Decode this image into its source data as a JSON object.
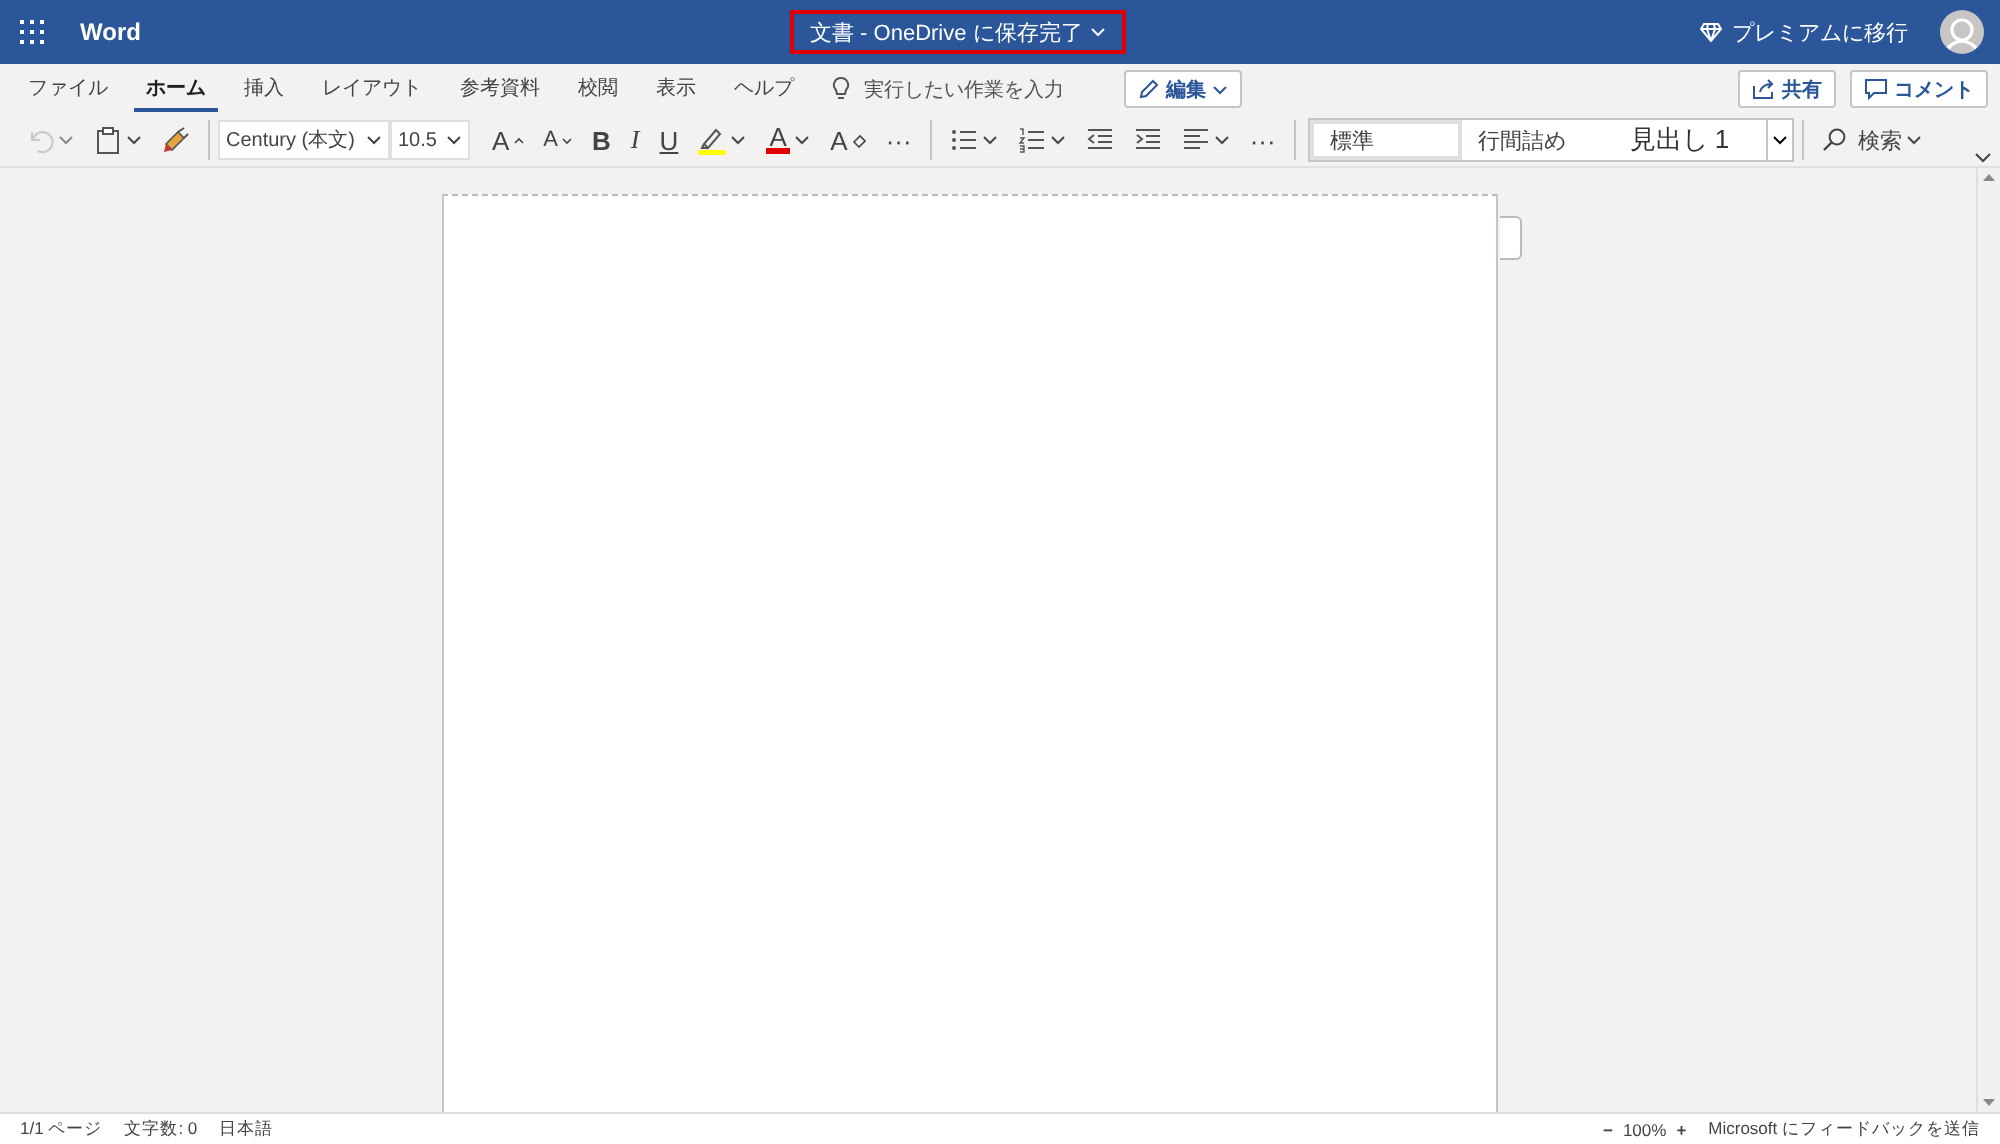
{
  "app": {
    "name": "Word",
    "doc_title": "文書 - OneDrive に保存完了",
    "title_highlighted": true,
    "premium": "プレミアムに移行"
  },
  "tabs": [
    {
      "label": "ファイル",
      "selected": false
    },
    {
      "label": "ホーム",
      "selected": true
    },
    {
      "label": "挿入",
      "selected": false
    },
    {
      "label": "レイアウト",
      "selected": false
    },
    {
      "label": "参考資料",
      "selected": false
    },
    {
      "label": "校閲",
      "selected": false
    },
    {
      "label": "表示",
      "selected": false
    },
    {
      "label": "ヘルプ",
      "selected": false
    }
  ],
  "tell_me": {
    "placeholder": "実行したい作業を入力"
  },
  "mode_button": "編集",
  "share_button": "共有",
  "comment_button": "コメント",
  "toolbar": [
    {
      "kind": "undo",
      "dropdown": true,
      "disabled": true
    },
    {
      "kind": "paste",
      "dropdown": true,
      "disabled": false
    },
    {
      "kind": "painter",
      "dropdown": false,
      "disabled": false
    },
    {
      "kind": "sep"
    },
    {
      "kind": "font",
      "value": "Century (本文)"
    },
    {
      "kind": "size",
      "value": "10.5"
    },
    {
      "kind": "grow",
      "label": "A"
    },
    {
      "kind": "shrink",
      "label": "A"
    },
    {
      "kind": "bold",
      "label": "B"
    },
    {
      "kind": "italic",
      "label": "I"
    },
    {
      "kind": "underline",
      "label": "U"
    },
    {
      "kind": "highlight",
      "dropdown": true,
      "color": "#ffff00"
    },
    {
      "kind": "fontcolor",
      "label": "A",
      "dropdown": true,
      "color": "#e00000"
    },
    {
      "kind": "clear",
      "label": "A"
    },
    {
      "kind": "more",
      "label": "···"
    },
    {
      "kind": "sep"
    },
    {
      "kind": "bullets",
      "dropdown": true
    },
    {
      "kind": "numbering",
      "dropdown": true
    },
    {
      "kind": "outdent",
      "dropdown": false
    },
    {
      "kind": "indent",
      "dropdown": false
    },
    {
      "kind": "align",
      "dropdown": true
    },
    {
      "kind": "more",
      "label": "···"
    },
    {
      "kind": "sep"
    },
    {
      "kind": "styles",
      "items": [
        {
          "label": "標準",
          "selected": true
        },
        {
          "label": "行間詰め",
          "selected": false
        },
        {
          "label": "見出し 1",
          "selected": false
        }
      ]
    },
    {
      "kind": "sep"
    },
    {
      "kind": "find",
      "label": "検索"
    }
  ],
  "status_bar": {
    "left": [
      "1/1 ページ",
      "文字数: 0",
      "日本語"
    ],
    "zoom_out": "−",
    "zoom": "100%",
    "zoom_in": "+",
    "feedback": "Microsoft にフィードバックを送信"
  }
}
